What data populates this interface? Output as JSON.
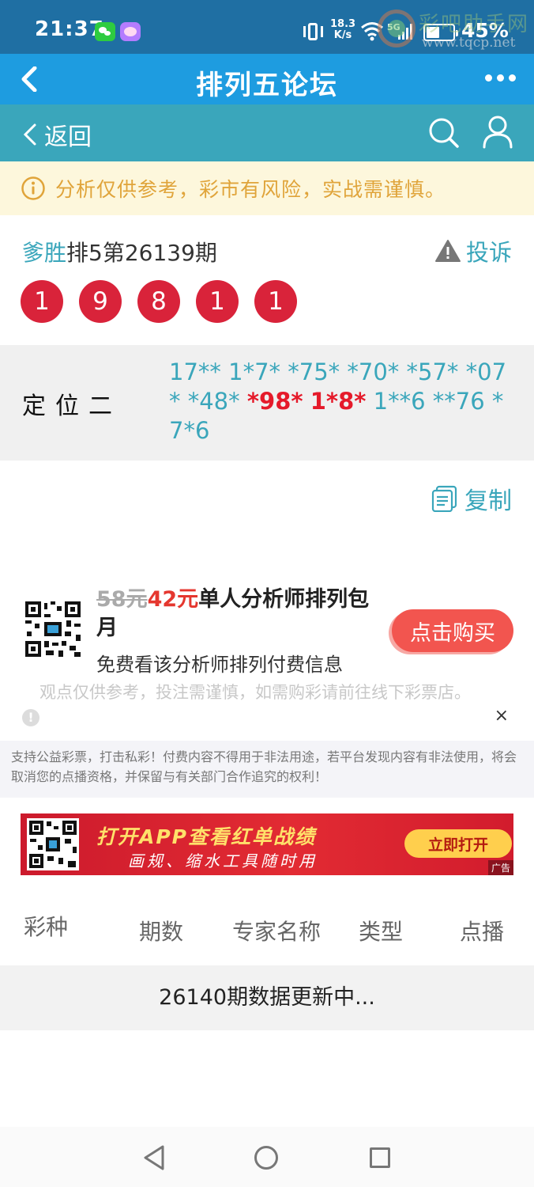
{
  "status_bar": {
    "time": "21:37",
    "net_speed_value": "18.3",
    "net_speed_unit": "K/s",
    "network": "5G",
    "battery": "45%",
    "icons": [
      "wechat-icon",
      "app-icon",
      "vibrate-icon",
      "wifi-icon",
      "signal-icon",
      "battery-icon"
    ]
  },
  "watermark": {
    "title": "彩吧助手网",
    "url": "www.tqcp.net"
  },
  "titlebar": {
    "title": "排列五论坛",
    "icons": [
      "back-arrow-icon",
      "more-dots-icon"
    ]
  },
  "subbar": {
    "back_label": "返回",
    "icons": [
      "chevron-left-icon",
      "search-icon",
      "user-icon"
    ]
  },
  "notice": {
    "text": "分析仅供参考，彩市有风险，实战需谨慎。",
    "icon": "info-circle-icon"
  },
  "pick": {
    "author": "爹胜",
    "issue_title": "排5第26139期",
    "complain_label": "投诉",
    "numbers": [
      "1",
      "9",
      "8",
      "1",
      "1"
    ]
  },
  "prediction": {
    "label": "定位二",
    "items": [
      {
        "text": "17**",
        "hit": false
      },
      {
        "text": "1*7*",
        "hit": false
      },
      {
        "text": "*75*",
        "hit": false
      },
      {
        "text": "*70*",
        "hit": false
      },
      {
        "text": "*57*",
        "hit": false
      },
      {
        "text": "*07*",
        "hit": false
      },
      {
        "text": "*48*",
        "hit": false
      },
      {
        "text": "*98*",
        "hit": true
      },
      {
        "text": "1*8*",
        "hit": true
      },
      {
        "text": "1**6",
        "hit": false
      },
      {
        "text": "**76",
        "hit": false
      },
      {
        "text": "*7*6",
        "hit": false
      }
    ]
  },
  "copy": {
    "label": "复制",
    "icon": "copy-icon"
  },
  "promo": {
    "old_price": "58元",
    "new_price": "42元",
    "title_rest": "单人分析师排列包月",
    "subtitle": "免费看该分析师排列付费信息",
    "buy_label": "点击购买",
    "disclaimer": "观点仅供参考，投注需谨慎，如需购彩请前往线下彩票店。",
    "close": "×",
    "info": "!"
  },
  "legal": {
    "text": "支持公益彩票，打击私彩！付费内容不得用于非法用途，若平台发现内容有非法使用，将会取消您的点播资格，并保留与有关部门合作追究的权利！"
  },
  "banner": {
    "line1": "打开APP查看红单战绩",
    "line2": "画规、缩水工具随时用",
    "button": "立即打开",
    "ad_label": "广告"
  },
  "table": {
    "headers": [
      "彩种",
      "期数",
      "专家名称",
      "类型",
      "点播"
    ]
  },
  "update": {
    "text": "26140期数据更新中..."
  },
  "colors": {
    "status_bar": "#1f6fa3",
    "title_bar": "#1e9ce0",
    "sub_bar": "#3aa6bb",
    "ball_red": "#d9233a",
    "hit_red": "#e51a2a",
    "buy_button": "#f2554f"
  }
}
